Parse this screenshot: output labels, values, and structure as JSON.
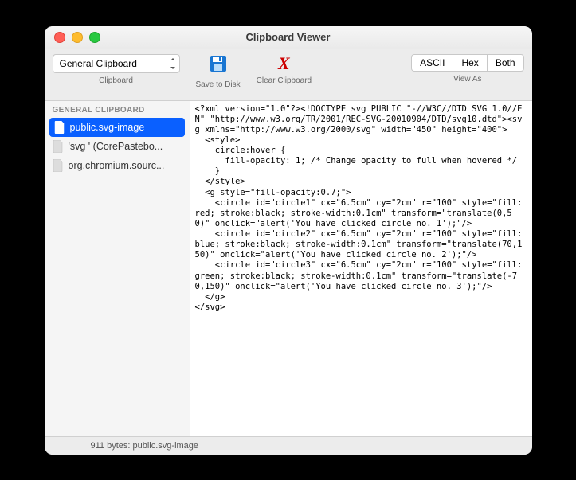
{
  "window": {
    "title": "Clipboard Viewer"
  },
  "toolbar": {
    "clipboard_selector": "General Clipboard",
    "clipboard_label": "Clipboard",
    "save_label": "Save to Disk",
    "clear_label": "Clear Clipboard",
    "viewas_label": "View As",
    "seg": {
      "ascii": "ASCII",
      "hex": "Hex",
      "both": "Both"
    }
  },
  "sidebar": {
    "header": "GENERAL CLIPBOARD",
    "items": [
      {
        "label": "public.svg-image",
        "selected": true
      },
      {
        "label": "'svg ' (CorePastebo...",
        "selected": false
      },
      {
        "label": "org.chromium.sourc...",
        "selected": false
      }
    ]
  },
  "content": "<?xml version=\"1.0\"?><!DOCTYPE svg PUBLIC \"-//W3C//DTD SVG 1.0//EN\" \"http://www.w3.org/TR/2001/REC-SVG-20010904/DTD/svg10.dtd\"><svg xmlns=\"http://www.w3.org/2000/svg\" width=\"450\" height=\"400\">\n  <style>\n    circle:hover {\n      fill-opacity: 1; /* Change opacity to full when hovered */\n    }\n  </style>\n  <g style=\"fill-opacity:0.7;\">\n    <circle id=\"circle1\" cx=\"6.5cm\" cy=\"2cm\" r=\"100\" style=\"fill:red; stroke:black; stroke-width:0.1cm\" transform=\"translate(0,50)\" onclick=\"alert('You have clicked circle no. 1');\"/>\n    <circle id=\"circle2\" cx=\"6.5cm\" cy=\"2cm\" r=\"100\" style=\"fill:blue; stroke:black; stroke-width:0.1cm\" transform=\"translate(70,150)\" onclick=\"alert('You have clicked circle no. 2');\"/>\n    <circle id=\"circle3\" cx=\"6.5cm\" cy=\"2cm\" r=\"100\" style=\"fill:green; stroke:black; stroke-width:0.1cm\" transform=\"translate(-70,150)\" onclick=\"alert('You have clicked circle no. 3');\"/>\n  </g>\n</svg>",
  "statusbar": {
    "text": "911 bytes: public.svg-image"
  }
}
